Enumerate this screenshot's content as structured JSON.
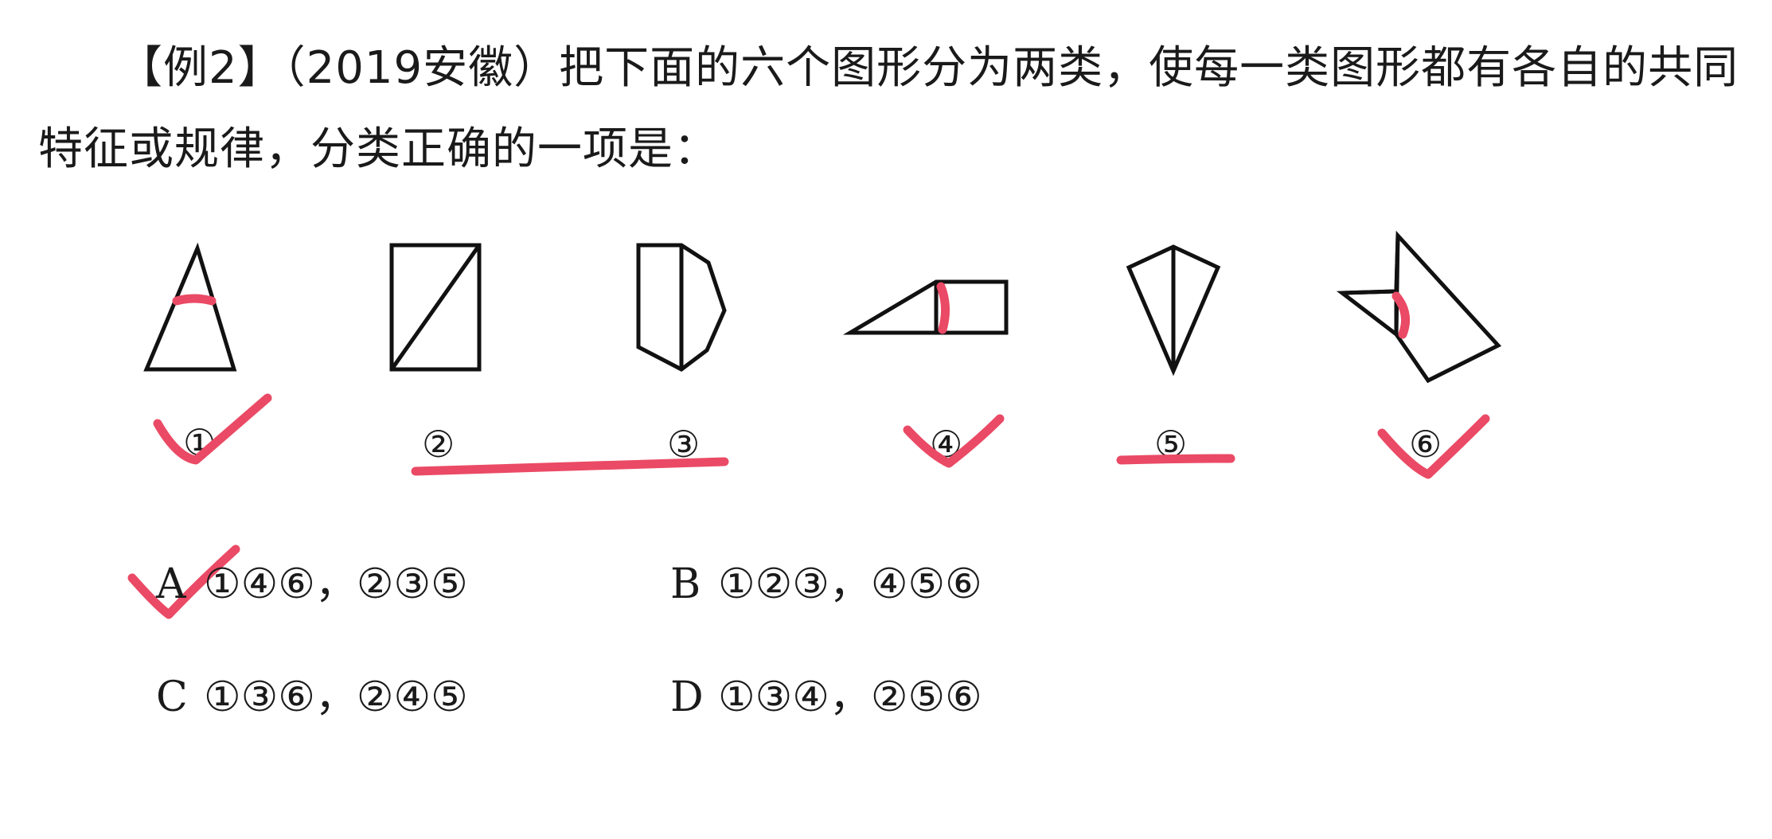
{
  "question": {
    "line1": "【例2】（2019安徽）把下面的六个图形分为两类，使每一类图形都有各自的共同",
    "line2": "特征或规律，分类正确的一项是："
  },
  "figures": [
    {
      "number": "①"
    },
    {
      "number": "②"
    },
    {
      "number": "③"
    },
    {
      "number": "④"
    },
    {
      "number": "⑤"
    },
    {
      "number": "⑥"
    }
  ],
  "options": [
    {
      "letter": "A",
      "text": "①④⑥，②③⑤"
    },
    {
      "letter": "B",
      "text": "①②③，④⑤⑥"
    },
    {
      "letter": "C",
      "text": "①③⑥，②④⑤"
    },
    {
      "letter": "D",
      "text": "①③④，②⑤⑥"
    }
  ],
  "colors": {
    "annotation": "#ea4a65",
    "ink": "#111111"
  }
}
